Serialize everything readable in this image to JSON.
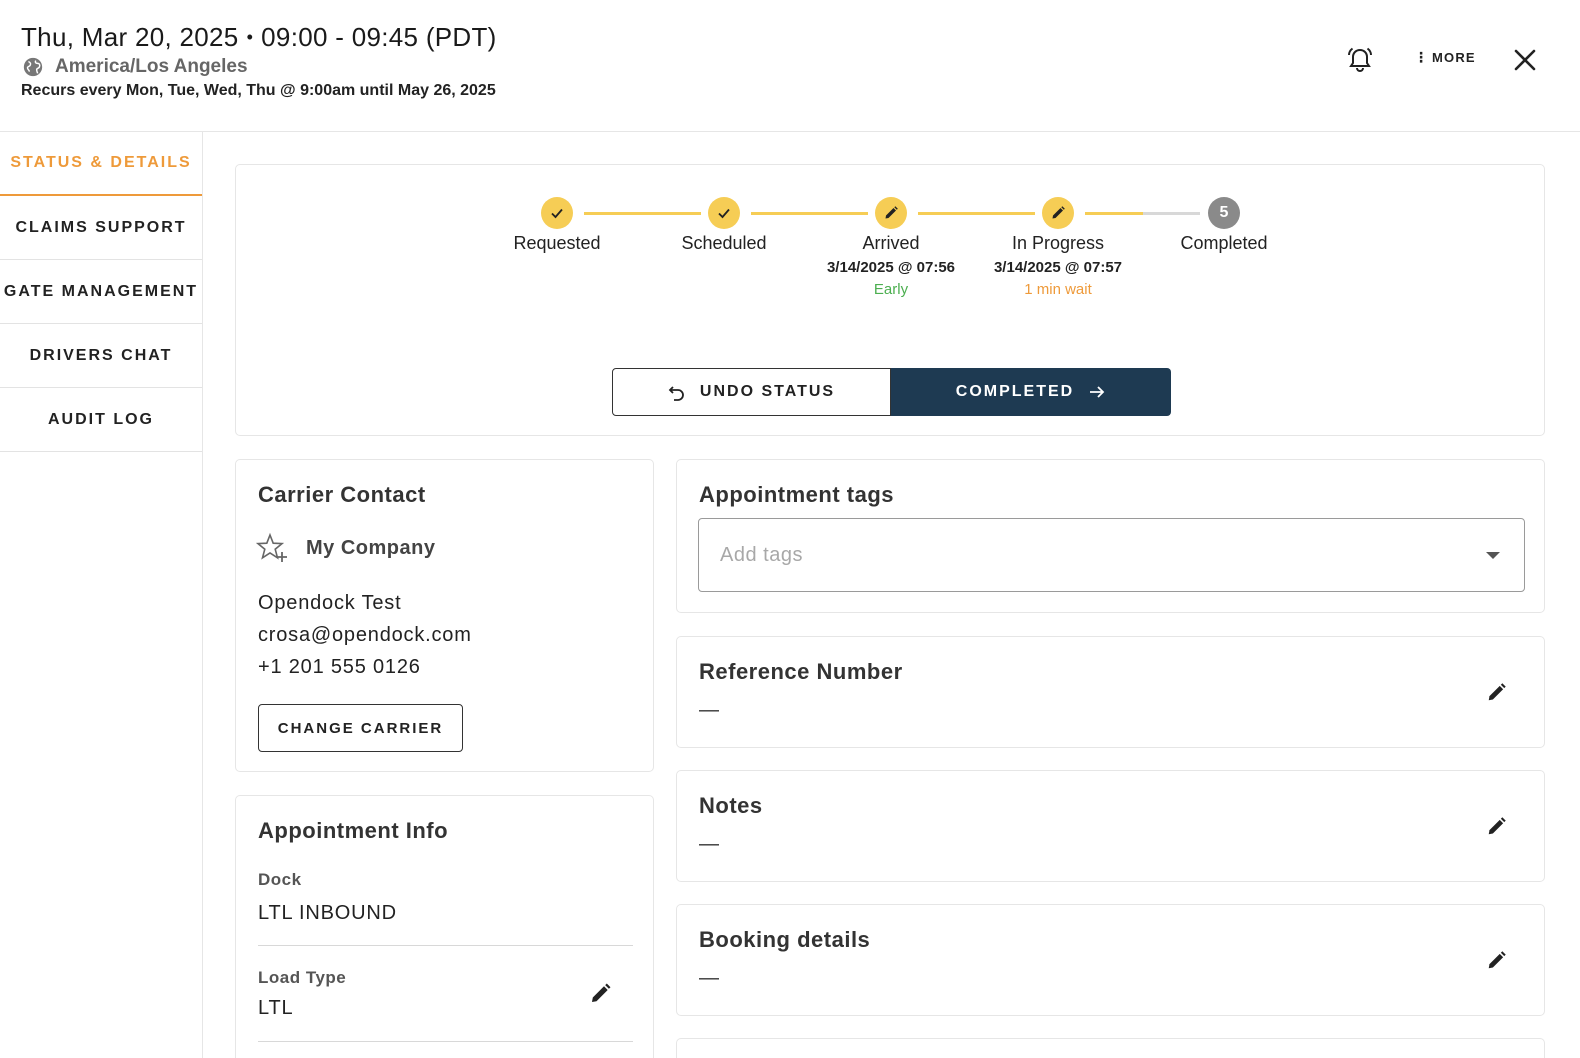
{
  "header": {
    "date": "Thu, Mar 20, 2025",
    "separator": "•",
    "time_range": "09:00 - 09:45 (PDT)",
    "timezone": "America/Los Angeles",
    "recurrence": "Recurs every Mon, Tue, Wed, Thu @ 9:00am until May 26, 2025",
    "more_label": "MORE",
    "more_kebab": "⋮"
  },
  "sidebar": {
    "items": [
      {
        "label": "STATUS & DETAILS",
        "active": true
      },
      {
        "label": "CLAIMS SUPPORT",
        "active": false
      },
      {
        "label": "GATE MANAGEMENT",
        "active": false
      },
      {
        "label": "DRIVERS CHAT",
        "active": false
      },
      {
        "label": "AUDIT LOG",
        "active": false
      }
    ]
  },
  "status": {
    "steps": [
      {
        "label": "Requested",
        "state": "done",
        "icon": "check-icon"
      },
      {
        "label": "Scheduled",
        "state": "done",
        "icon": "check-icon"
      },
      {
        "label": "Arrived",
        "state": "editable",
        "icon": "pencil-icon",
        "time": "3/14/2025 @ 07:56",
        "note": "Early",
        "note_color": "#4caf50"
      },
      {
        "label": "In Progress",
        "state": "editable",
        "icon": "pencil-icon",
        "time": "3/14/2025 @ 07:57",
        "note": "1 min wait",
        "note_color": "#ee9a3a"
      },
      {
        "label": "Completed",
        "state": "pending",
        "number": "5"
      }
    ],
    "progress_last_segment": 0.5,
    "undo_label": "UNDO STATUS",
    "next_label": "COMPLETED"
  },
  "carrier": {
    "title": "Carrier Contact",
    "company": "My Company",
    "name": "Opendock Test",
    "email": "crosa@opendock.com",
    "phone": "+1 201 555 0126",
    "change_label": "CHANGE CARRIER"
  },
  "appointment_info": {
    "title": "Appointment Info",
    "dock_label": "Dock",
    "dock_value": "LTL INBOUND",
    "load_type_label": "Load Type",
    "load_type_value": "LTL"
  },
  "tags": {
    "title": "Appointment tags",
    "placeholder": "Add tags"
  },
  "reference": {
    "title": "Reference Number",
    "value": "—"
  },
  "notes": {
    "title": "Notes",
    "value": "—"
  },
  "booking": {
    "title": "Booking details",
    "value": "—"
  },
  "colors": {
    "accent": "#ee9a3a",
    "step_yellow": "#f6cd55",
    "primary_button": "#1e3a52",
    "early_green": "#4caf50"
  }
}
